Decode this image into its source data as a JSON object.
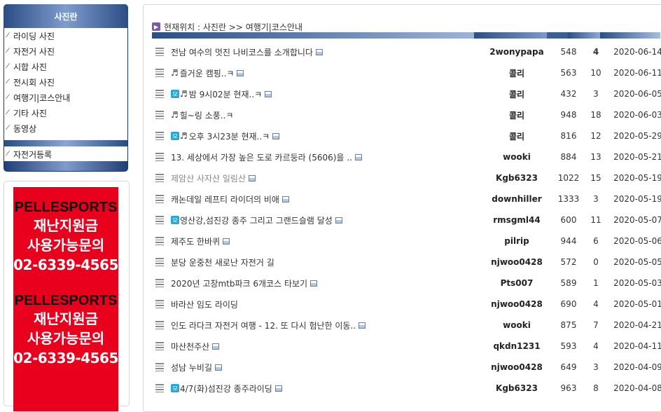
{
  "sidebar": {
    "title": "사진란",
    "items": [
      {
        "label": "라이딩 사진"
      },
      {
        "label": "자전거 사진"
      },
      {
        "label": "시합 사진"
      },
      {
        "label": "전시회 사진"
      },
      {
        "label": "여행기|코스안내"
      },
      {
        "label": "기타 사진"
      },
      {
        "label": "동영상"
      }
    ],
    "register": "자전거등록",
    "bullet": "⁄"
  },
  "banner": {
    "blocks": [
      {
        "brand": "PELLESPORTS",
        "line1": "재난지원금",
        "line2": "사용가능문의",
        "phone": "02-6339-4565"
      },
      {
        "brand": "PELLESPORTS",
        "line1": "재난지원금",
        "line2": "사용가능문의",
        "phone": "02-6339-4565"
      }
    ],
    "colors": {
      "bg": "#e8001d",
      "brand": "#111111",
      "text": "#ffffff"
    }
  },
  "location": {
    "text": "현재위치 : 사진란 >> 여행기|코스안내",
    "icon": "arrow-right-icon"
  },
  "posts": [
    {
      "title": "전남 여수의 멋진 나비코스를 소개합니다",
      "author": "2wonypapa",
      "hits": "548",
      "comments": "4",
      "date": "2020-06-14",
      "bold_comments": true
    },
    {
      "title": "즐거운 캠핑..ㅋ",
      "prefix": "♬",
      "author": "콜리",
      "hits": "563",
      "comments": "10",
      "date": "2020-06-11"
    },
    {
      "title": "밤 9시02분 현재..ㅋ",
      "badge": "모",
      "prefix": "♬",
      "author": "콜리",
      "hits": "432",
      "comments": "3",
      "date": "2020-06-05"
    },
    {
      "title": "힐~링 소풍..ㅋ",
      "prefix": "♬",
      "author": "콜리",
      "hits": "948",
      "comments": "18",
      "date": "2020-06-03",
      "no_pic": true
    },
    {
      "title": "오후 3시23분 현재..ㅋ",
      "badge": "모",
      "prefix": "♬",
      "author": "콜리",
      "hits": "816",
      "comments": "12",
      "date": "2020-05-29"
    },
    {
      "title": "13. 세상에서 가장 높은 도로 카르둥라 (5606)을 ..",
      "author": "wooki",
      "hits": "884",
      "comments": "13",
      "date": "2020-05-21"
    },
    {
      "title": "제암산 사자산 일림산",
      "author": "Kgb6323",
      "hits": "1022",
      "comments": "15",
      "date": "2020-05-19",
      "gray": true
    },
    {
      "title": "캐논데일 레프티 라이더의 비애",
      "author": "downhiller",
      "hits": "1333",
      "comments": "3",
      "date": "2020-05-19"
    },
    {
      "title": "영산강,섬진강 종주 그리고 그랜드슬램 달성",
      "badge": "모",
      "author": "rmsgml44",
      "hits": "600",
      "comments": "11",
      "date": "2020-05-07"
    },
    {
      "title": "제주도 한바퀴",
      "author": "pilrip",
      "hits": "944",
      "comments": "6",
      "date": "2020-05-06"
    },
    {
      "title": "분당 운중천 새로난 자전거 길",
      "author": "njwoo0428",
      "hits": "572",
      "comments": "0",
      "date": "2020-05-05",
      "no_pic": true
    },
    {
      "title": "2020년 고창mtb파크 6개코스 타보기",
      "author": "Pts007",
      "hits": "589",
      "comments": "1",
      "date": "2020-05-03"
    },
    {
      "title": "바라산 임도 라이딩",
      "author": "njwoo0428",
      "hits": "690",
      "comments": "4",
      "date": "2020-05-01",
      "no_pic": true
    },
    {
      "title": "인도 라다크 자전거 여행 - 12. 또 다시 험난한 이동..",
      "author": "wooki",
      "hits": "875",
      "comments": "7",
      "date": "2020-04-21"
    },
    {
      "title": "마산천주산",
      "author": "qkdn1231",
      "hits": "593",
      "comments": "4",
      "date": "2020-04-11"
    },
    {
      "title": "성남 누비길",
      "author": "njwoo0428",
      "hits": "649",
      "comments": "3",
      "date": "2020-04-09"
    },
    {
      "title": "4/7(화)섬진강 종주라이딩",
      "badge": "모",
      "author": "Kgb6323",
      "hits": "963",
      "comments": "8",
      "date": "2020-04-08"
    }
  ]
}
